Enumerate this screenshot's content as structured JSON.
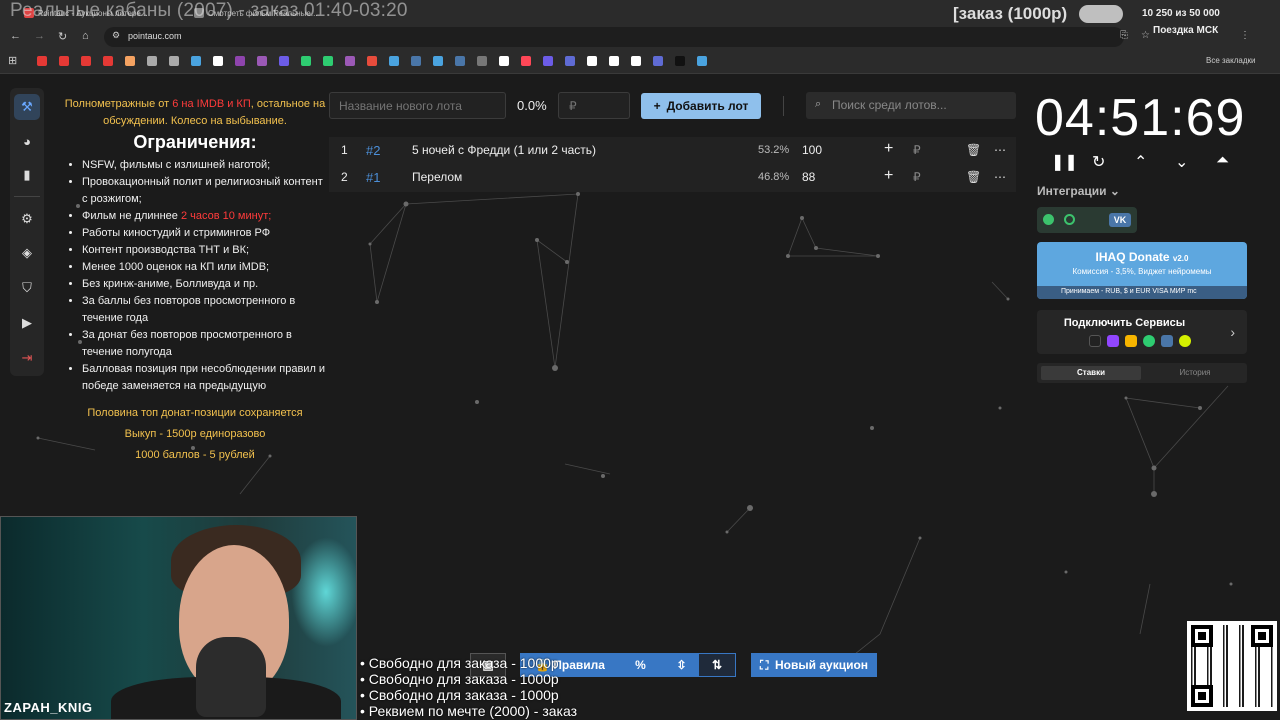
{
  "stream": {
    "title": "Реальные кабаны (2007) - заказ 01:40-03:20",
    "order_label": "[заказ (1000р)",
    "goal_text": "10 250  из 50 000",
    "trip_text": "Поездка МСК",
    "streamer_name": "ZAPAH_KNIG",
    "ticker": [
      "• Свободно для заказа - 1000р",
      "• Свободно для заказа - 1000р",
      "• Свободно для заказа - 1000р",
      "• Реквием по мечте (2000) - заказ"
    ]
  },
  "browser": {
    "tabs": [
      "Pointauc - Аукционы лотере...",
      "Смотреть фильм Реальные..."
    ],
    "url": "pointauc.com",
    "all_bookmarks": "Все закладки",
    "bookmark_colors": [
      "#e53935",
      "#e53935",
      "#e53935",
      "#e53935",
      "#f4a261",
      "#aaaaaa",
      "#aaaaaa",
      "#4aa3df",
      "#ffffff",
      "#8e44ad",
      "#9b59b6",
      "#6c5ce7",
      "#2ecc71",
      "#2ecc71",
      "#9b59b6",
      "#e74c3c",
      "#4aa3df",
      "#4a76a8",
      "#4aa3df",
      "#4a76a8",
      "#777777",
      "#ffffff",
      "#ff4757",
      "#6c5ce7",
      "#5f6bd4",
      "#ffffff",
      "#ffffff",
      "#ffffff",
      "#5f6bd4",
      "#111111",
      "#4aa3df"
    ]
  },
  "rules": {
    "intro_pre": "Полнометражные от",
    "intro_red": "6 на IMDB и КП",
    "intro_post": ", остальное на обсуждении. Колесо на выбывание.",
    "title": "Ограничения:",
    "items": [
      "NSFW, фильмы с излишней наготой;",
      "Провокационный полит и религиозный контент с розжигом;",
      "Фильм не длиннее ",
      "Работы киностудий и стримингов РФ",
      "Контент производства ТНТ и ВК;",
      "Менее 1000 оценок на КП или iMDB;",
      "Без кринж-аниме, Болливуда и пр.",
      "За баллы без повторов просмотренного в течение года",
      "За донат без повторов просмотренного в течение полугода",
      "Балловая позиция при несоблюдении правил и победе заменяется на предыдущую"
    ],
    "length_red": "2 часов 10 минут;",
    "footer": [
      "Половина топ донат-позиции сохраняется",
      "Выкуп - 1500р единоразово",
      "1000 баллов - 5 рублей"
    ]
  },
  "toolbar": {
    "lot_placeholder": "Название нового лота",
    "percent": "0.0%",
    "price_placeholder": "₽",
    "add_label": "Добавить лот",
    "search_placeholder": "Поиск среди лотов..."
  },
  "lots": [
    {
      "num": "1",
      "id": "#2",
      "name": "5 ночей с Фредди (1 или 2 часть)",
      "percent": "53.2%",
      "amount": "100"
    },
    {
      "num": "2",
      "id": "#1",
      "name": "Перелом",
      "percent": "46.8%",
      "amount": "88"
    }
  ],
  "timer": {
    "value": "04:51:69"
  },
  "integrations": {
    "title": "Интеграции",
    "vk_label": "VK"
  },
  "donate": {
    "title": "IHAQ Donate",
    "version": "v2.0",
    "subtitle": "Комиссия - 3,5%, Виджет нейромемы",
    "pay": "Принимаем - RUB, $ и EUR  VISA  МИР  mc"
  },
  "services": {
    "title": "Подключить Сервисы"
  },
  "bets_tabs": {
    "active": "Ставки",
    "inactive": "История"
  },
  "bottom": {
    "rules": "Правила",
    "new_auction": "Новый аукцион"
  },
  "colors": {
    "accent": "#8fc0ec",
    "id_blue": "#4c8fd8",
    "warning": "#f2c14e",
    "red": "#ff3b3b"
  }
}
